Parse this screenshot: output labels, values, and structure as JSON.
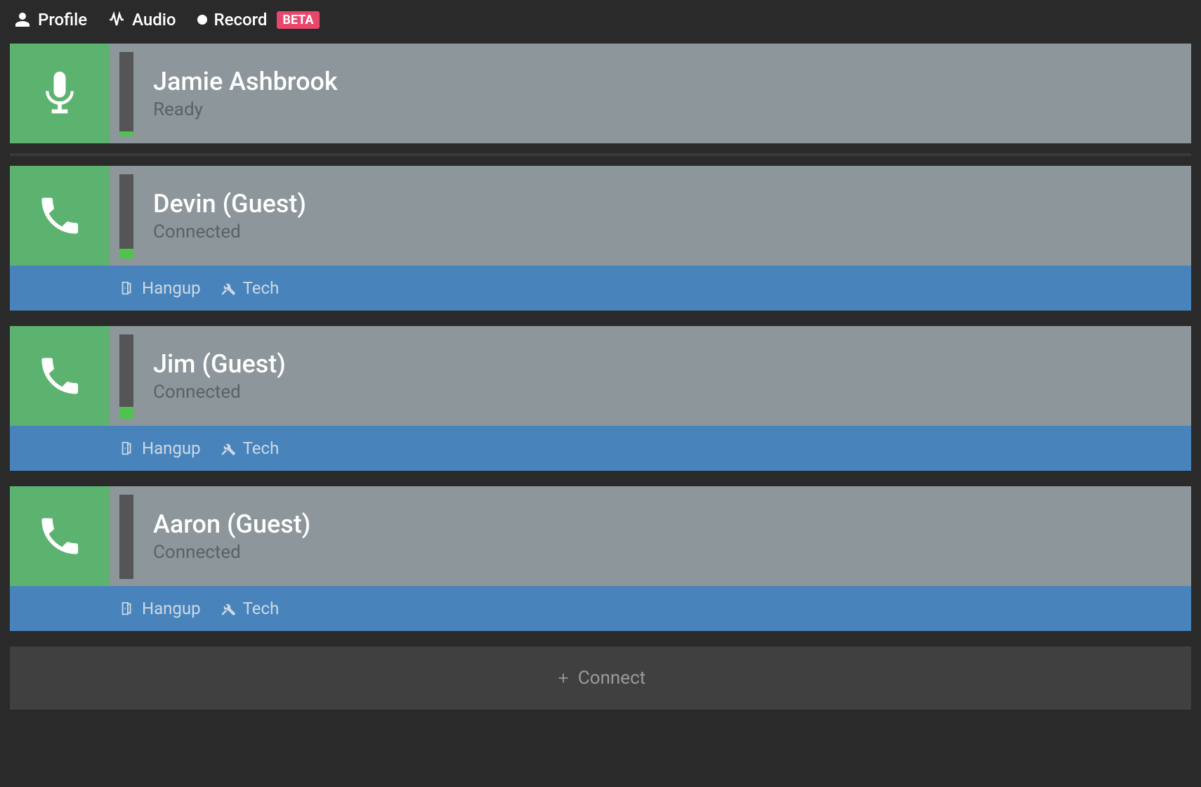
{
  "topbar": {
    "profile": "Profile",
    "audio": "Audio",
    "record": "Record",
    "beta": "BETA"
  },
  "host": {
    "name": "Jamie Ashbrook",
    "status": "Ready",
    "meter_pct": 6
  },
  "guests": [
    {
      "name": "Devin (Guest)",
      "status": "Connected",
      "meter_pct": 12,
      "hangup": "Hangup",
      "tech": "Tech"
    },
    {
      "name": "Jim (Guest)",
      "status": "Connected",
      "meter_pct": 14,
      "hangup": "Hangup",
      "tech": "Tech"
    },
    {
      "name": "Aaron (Guest)",
      "status": "Connected",
      "meter_pct": 0,
      "hangup": "Hangup",
      "tech": "Tech"
    }
  ],
  "connect": "Connect"
}
